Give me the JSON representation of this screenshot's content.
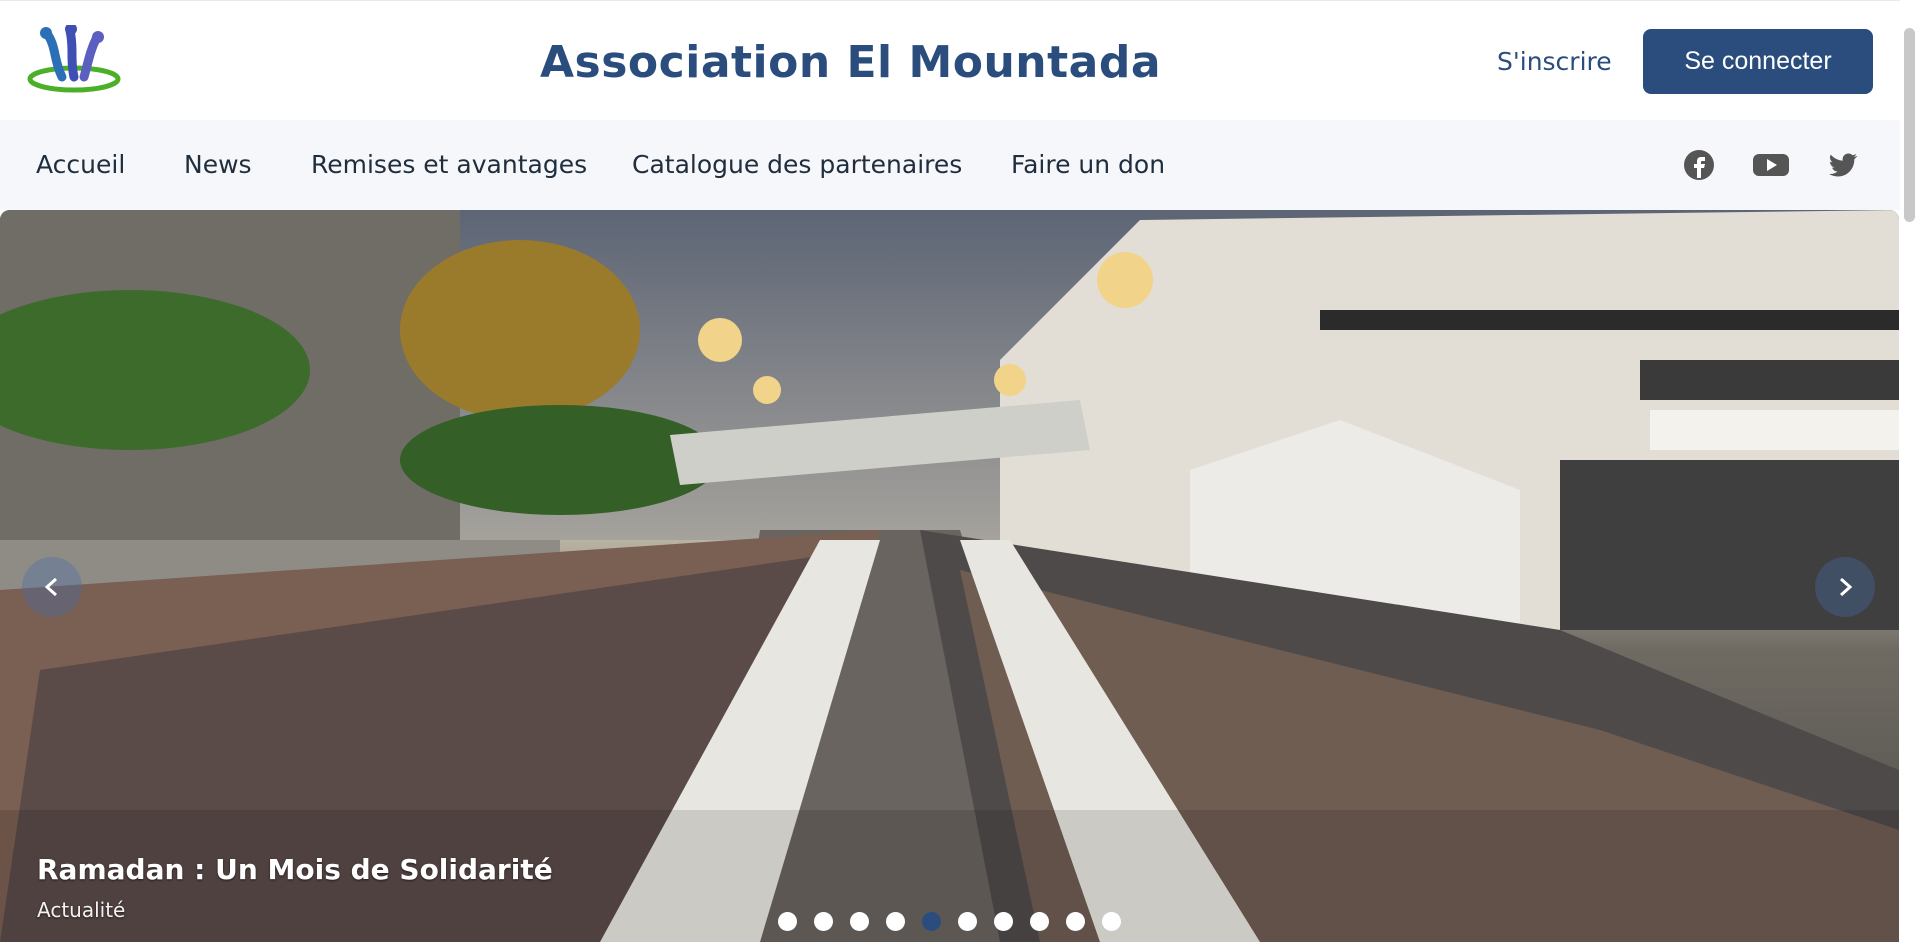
{
  "header": {
    "title": "Association El Mountada",
    "signup_label": "S'inscrire",
    "login_label": "Se connecter"
  },
  "nav": {
    "items": [
      {
        "label": "Accueil"
      },
      {
        "label": "News"
      },
      {
        "label": "Remises et avantages"
      },
      {
        "label": "Catalogue des partenaires"
      },
      {
        "label": "Faire un don"
      }
    ],
    "social": [
      "facebook-icon",
      "youtube-icon",
      "twitter-icon"
    ]
  },
  "hero": {
    "title": "Ramadan : Un Mois de Solidarité",
    "category": "Actualité",
    "slides_count": 10,
    "active_slide": 5
  },
  "colors": {
    "brand": "#2a4d7e",
    "nav_bg": "#f5f7fa"
  }
}
